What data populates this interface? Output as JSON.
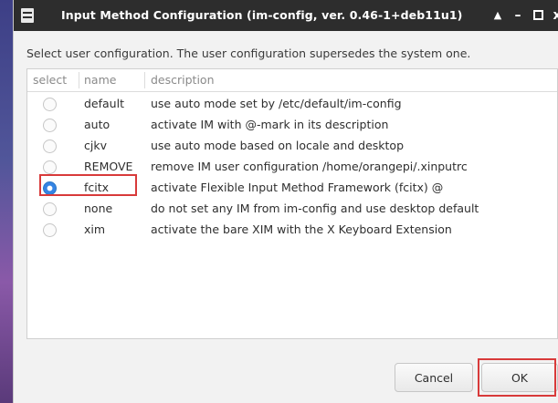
{
  "window": {
    "title": "Input Method Configuration (im-config, ver. 0.46-1+deb11u1)",
    "controls": {
      "up": "▲",
      "minimize": "–",
      "close": "x"
    }
  },
  "instruction": "Select user configuration. The user configuration supersedes the system one.",
  "table": {
    "headers": {
      "select": "select",
      "name": "name",
      "description": "description"
    },
    "rows": [
      {
        "name": "default",
        "description": "use auto mode set by /etc/default/im-config",
        "selected": false
      },
      {
        "name": "auto",
        "description": "activate IM with @-mark in its description",
        "selected": false
      },
      {
        "name": "cjkv",
        "description": "use auto mode based on locale and desktop",
        "selected": false
      },
      {
        "name": "REMOVE",
        "description": "remove IM user configuration /home/orangepi/.xinputrc",
        "selected": false
      },
      {
        "name": "fcitx",
        "description": "activate Flexible Input Method Framework (fcitx) @",
        "selected": true
      },
      {
        "name": "none",
        "description": "do not set any IM from im-config and use desktop default",
        "selected": false
      },
      {
        "name": "xim",
        "description": "activate the bare XIM with the X Keyboard Extension",
        "selected": false
      }
    ]
  },
  "buttons": {
    "cancel": "Cancel",
    "ok": "OK"
  },
  "colors": {
    "titlebar": "#2d2d2d",
    "highlight": "#d83a3a",
    "radio_selected": "#3584e4"
  }
}
